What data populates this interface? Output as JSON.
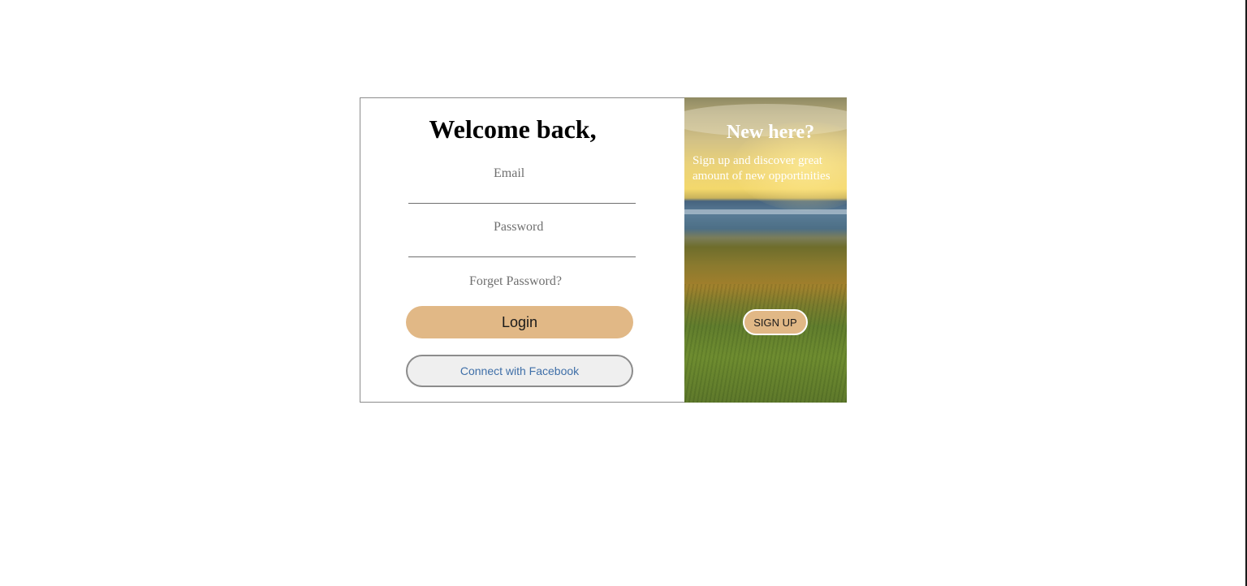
{
  "login": {
    "title": "Welcome back,",
    "email_label": "Email",
    "email_value": "",
    "password_label": "Password",
    "password_value": "",
    "forget_password": "Forget Password?",
    "login_button": "Login",
    "facebook_button": "Connect with Facebook"
  },
  "signup": {
    "title": "New here?",
    "description_line1": "Sign up and discover great",
    "description_line2": "amount of new opportinities",
    "button": "SIGN UP"
  },
  "colors": {
    "accent": "#e1b886",
    "facebook_text": "#3f6fa8",
    "label_gray": "#6f6f6f"
  }
}
